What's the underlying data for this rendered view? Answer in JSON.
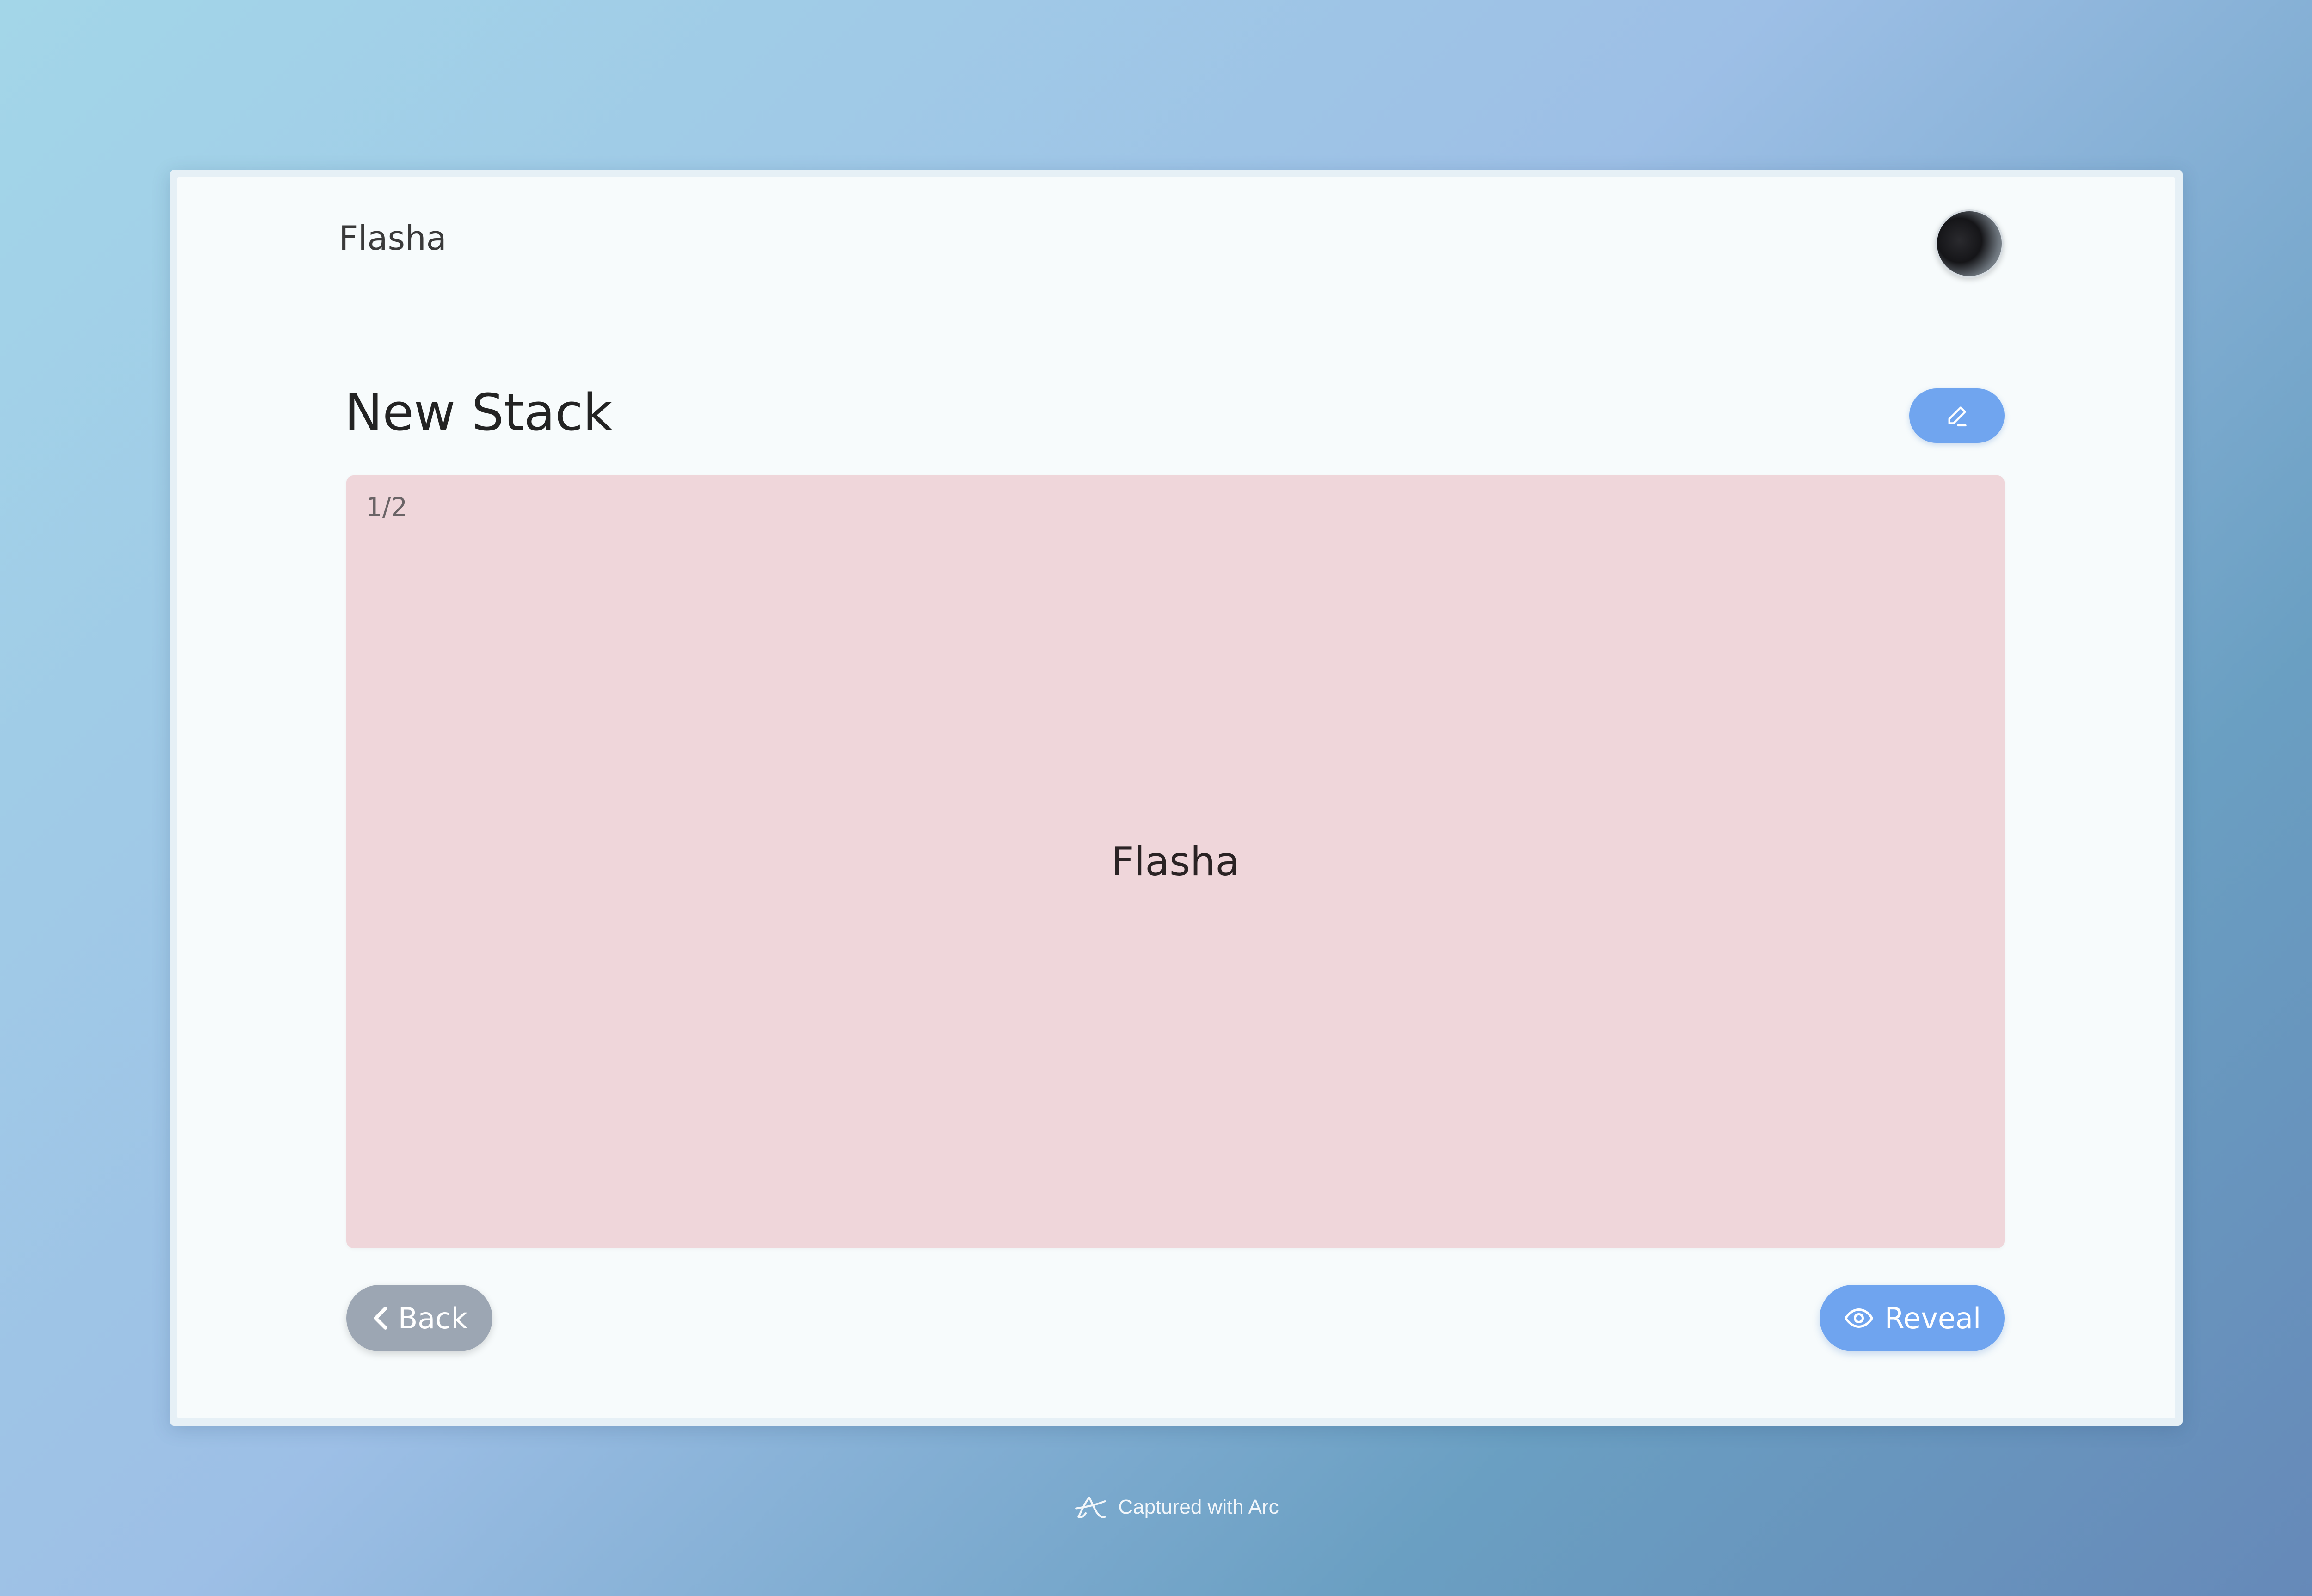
{
  "header": {
    "app_name": "Flasha",
    "avatar_icon": "user-avatar"
  },
  "stack": {
    "title": "New Stack",
    "edit_icon": "pencil-icon"
  },
  "card": {
    "counter": "1/2",
    "text": "Flasha",
    "background_color": "#efd6da"
  },
  "actions": {
    "back_label": "Back",
    "back_icon": "chevron-left-icon",
    "reveal_label": "Reveal",
    "reveal_icon": "eye-icon"
  },
  "footer": {
    "caption": "Captured with Arc",
    "icon": "arc-logo"
  },
  "colors": {
    "accent": "#70a5ef",
    "secondary_button": "#9ca6b3"
  }
}
